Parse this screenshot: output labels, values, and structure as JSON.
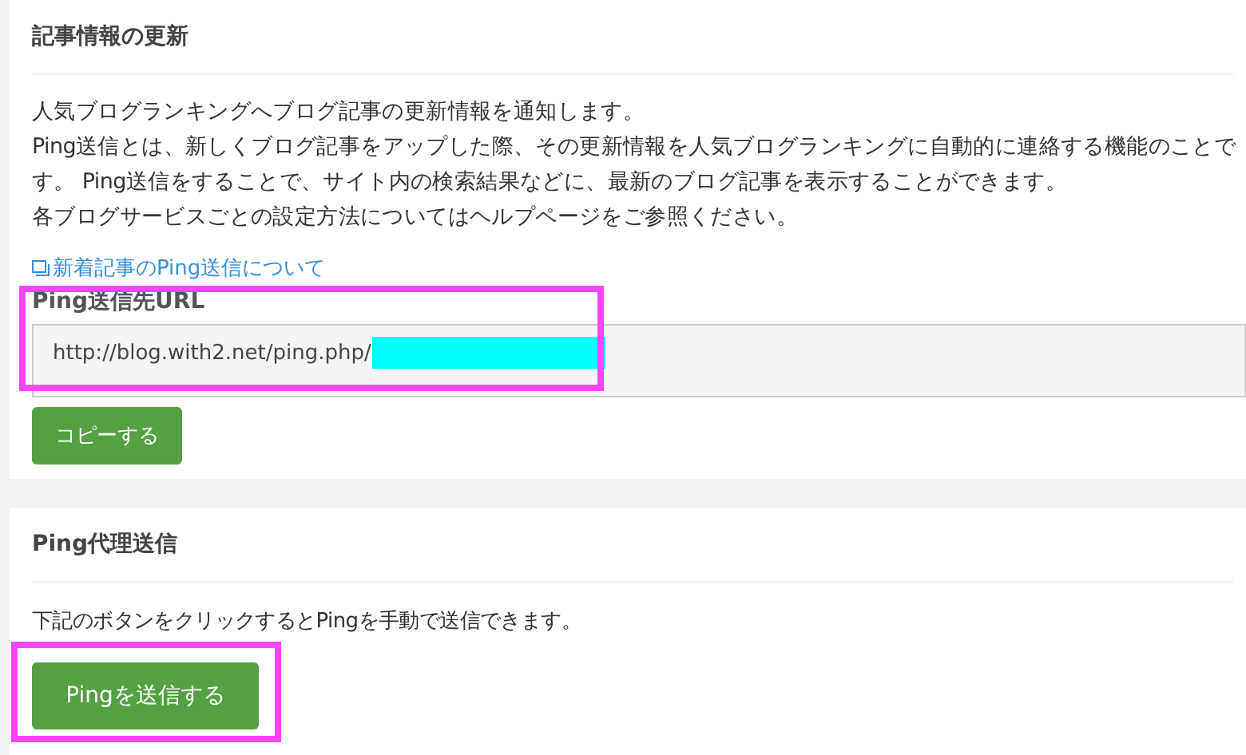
{
  "update_section": {
    "title": "記事情報の更新",
    "paragraphs": [
      "人気ブログランキングへブログ記事の更新情報を通知します。",
      "Ping送信とは、新しくブログ記事をアップした際、その更新情報を人気ブログランキングに自動的に連絡する機能のことです。 Ping送信をすることで、サイト内の検索結果などに、最新のブログ記事を表示することができます。",
      "各ブログサービスごとの設定方法についてはヘルプページをご参照ください。"
    ],
    "link": "新着記事のPing送信について",
    "url_label": "Ping送信先URL",
    "url_value": "http://blog.with2.net/ping.php/",
    "copy_button": "コピーする"
  },
  "proxy_section": {
    "title": "Ping代理送信",
    "description": "下記のボタンをクリックするとPingを手動で送信できます。",
    "send_button": "Pingを送信する"
  }
}
